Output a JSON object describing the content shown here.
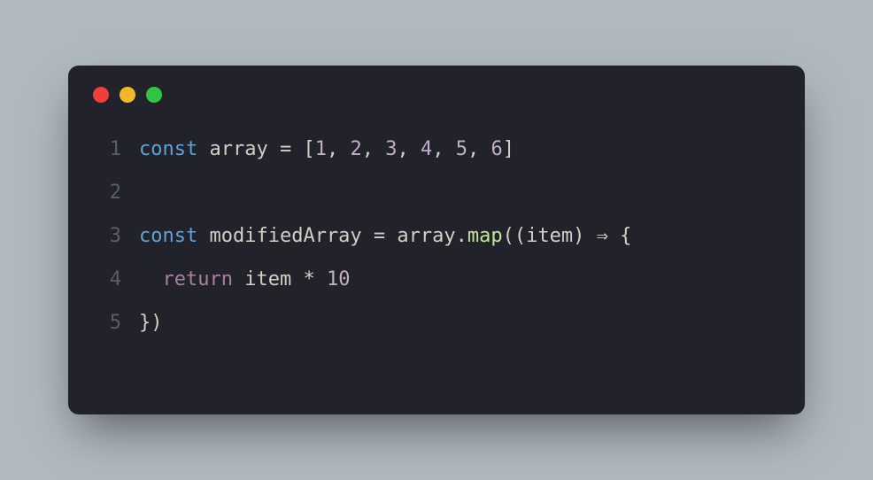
{
  "editor": {
    "window_controls": [
      "red",
      "yellow",
      "green"
    ],
    "lines": [
      {
        "number": "1"
      },
      {
        "number": "2"
      },
      {
        "number": "3"
      },
      {
        "number": "4"
      },
      {
        "number": "5"
      }
    ],
    "code": {
      "line1": {
        "const": "const",
        "array": "array",
        "equals": " = ",
        "lbracket": "[",
        "n1": "1",
        "c1": ", ",
        "n2": "2",
        "c2": ", ",
        "n3": "3",
        "c3": ", ",
        "n4": "4",
        "c4": ", ",
        "n5": "5",
        "c5": ", ",
        "n6": "6",
        "rbracket": "]"
      },
      "line3": {
        "const": "const",
        "modifiedArray": "modifiedArray",
        "equals": " = ",
        "array": "array",
        "dot": ".",
        "map": "map",
        "lparen1": "(",
        "lparen2": "(",
        "item": "item",
        "rparen2": ")",
        "arrow": " ⇒ ",
        "lbrace": "{"
      },
      "line4": {
        "indent": "  ",
        "return": "return",
        "space": " ",
        "item": "item",
        "times": " * ",
        "ten": "10"
      },
      "line5": {
        "rbrace": "}",
        "rparen": ")"
      }
    }
  }
}
